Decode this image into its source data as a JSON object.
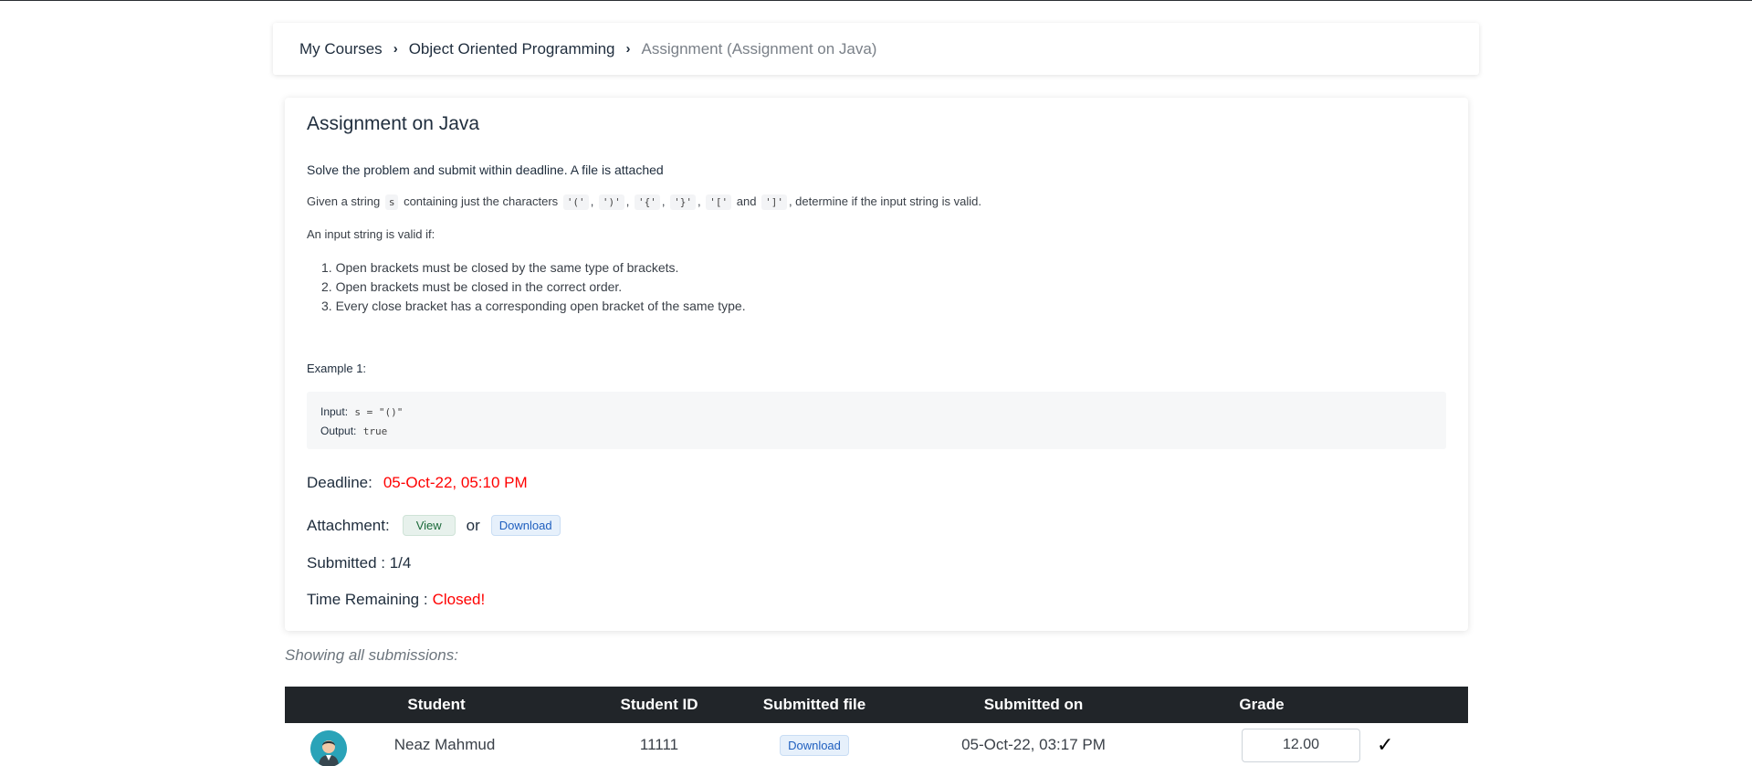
{
  "breadcrumb": {
    "items": [
      "My Courses",
      "Object Oriented Programming"
    ],
    "current": "Assignment (Assignment on Java)",
    "separator": "›"
  },
  "assignment": {
    "title": "Assignment on Java",
    "subtitle": "Solve the problem and submit within deadline. A file is attached",
    "desc_pre": "Given a string",
    "desc_var": "s",
    "desc_mid": "containing just the characters",
    "chars": [
      "'('",
      "')'",
      "'{'",
      "'}'",
      "'['"
    ],
    "desc_and": "and",
    "last_char": "']'",
    "desc_post": ", determine if the input string is valid.",
    "valid_if": "An input string is valid if:",
    "rules": [
      "1. Open brackets must be closed by the same type of brackets.",
      "2. Open brackets must be closed in the correct order.",
      "3. Every close bracket has a corresponding open bracket of the same type."
    ],
    "example_label": "Example 1:",
    "example_input_label": "Input:",
    "example_input_value": "s = \"()\"",
    "example_output_label": "Output:",
    "example_output_value": "true"
  },
  "deadline": {
    "label": "Deadline:",
    "value": "05-Oct-22, 05:10 PM"
  },
  "attachment": {
    "label": "Attachment:",
    "view": "View",
    "or": "or",
    "download": "Download"
  },
  "submitted": {
    "label": "Submitted : 1/4"
  },
  "time_remaining": {
    "label": "Time Remaining :",
    "value": "Closed!"
  },
  "submissions": {
    "heading": "Showing all submissions:",
    "columns": [
      "Student",
      "Student ID",
      "Submitted file",
      "Submitted on",
      "Grade"
    ],
    "rows": [
      {
        "student": "Neaz Mahmud",
        "id": "11111",
        "file": "Download",
        "submitted_on": "05-Oct-22, 03:17 PM",
        "grade": "12.00",
        "check": "✓"
      }
    ]
  },
  "colors": {
    "accent_red": "#ff0000",
    "table_header": "#212529",
    "avatar": "#2aa3b8"
  }
}
